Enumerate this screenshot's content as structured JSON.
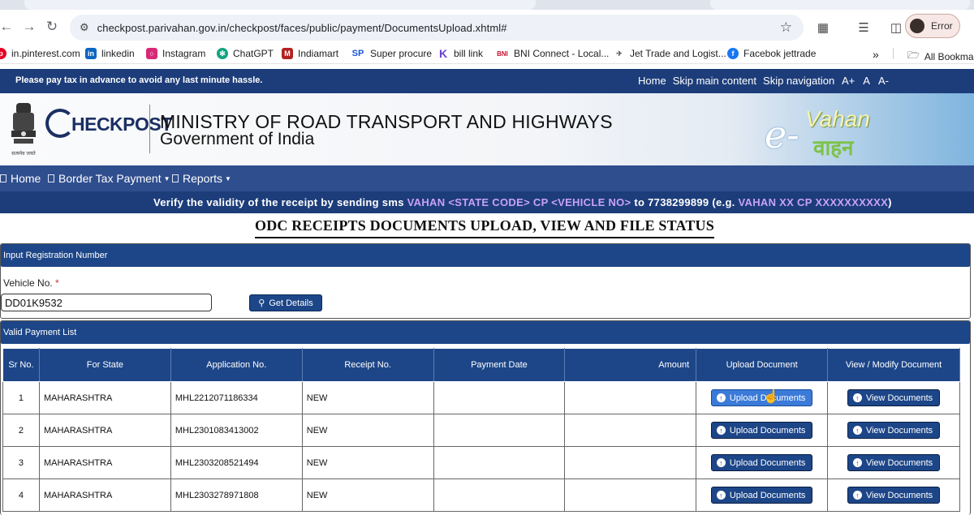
{
  "browser": {
    "url": "checkpost.parivahan.gov.in/checkpost/faces/public/payment/DocumentsUpload.xhtml#",
    "profile_status": "Error",
    "bookmarks": [
      {
        "label": "in.pinterest.com",
        "color": "#e60023"
      },
      {
        "label": "linkedin",
        "color": "#0a66c2"
      },
      {
        "label": "Instagram",
        "color": "#d62976"
      },
      {
        "label": "ChatGPT",
        "color": "#10a37f"
      },
      {
        "label": "Indiamart",
        "color": "#b22222"
      },
      {
        "label": "Super procure",
        "color": "#1a55d6"
      },
      {
        "label": "bill link",
        "color": "#6b3fd4"
      },
      {
        "label": "BNI Connect - Local...",
        "color": "#c8102e"
      },
      {
        "label": "Jet Trade and Logist...",
        "color": "#555555"
      },
      {
        "label": "Facebok jettrade",
        "color": "#1877f2"
      }
    ],
    "all_bookmarks": "All Bookmar"
  },
  "site": {
    "notice": "Please pay tax in advance to avoid any last minute hassle.",
    "top_links": [
      "Home",
      "Skip main content",
      "Skip navigation"
    ],
    "font_sizes": [
      "A+",
      "A",
      "A-"
    ],
    "logo": "HECKPOST",
    "ministry_line1": "MINISTRY OF ROAD TRANSPORT AND HIGHWAYS",
    "ministry_line2": "Government of India",
    "emblem_caption": "सत्यमेव जयते",
    "evahan_e": "e-",
    "evahan_vahan": "Vahan",
    "evahan_hindi": "वाहन",
    "menu": {
      "home": "Home",
      "border_tax": "Border Tax Payment",
      "reports": "Reports"
    },
    "sms": {
      "prefix": "Verify the validity of the receipt by sending sms",
      "code": "VAHAN <STATE CODE> CP <VEHICLE NO>",
      "middle": "to 7738299899 (e.g.",
      "example": "VAHAN XX CP XXXXXXXXXX",
      "suffix": ")"
    },
    "page_title": "ODC RECEIPTS DOCUMENTS UPLOAD, VIEW AND FILE STATUS"
  },
  "input_panel": {
    "heading": "Input Registration Number",
    "vehicle_label": "Vehicle No.",
    "required_mark": "*",
    "vehicle_value": "DD01K9532",
    "get_details": "Get Details"
  },
  "payment_panel": {
    "heading": "Valid Payment List",
    "columns": [
      "Sr No.",
      "For State",
      "Application No.",
      "Receipt No.",
      "Payment Date",
      "Amount",
      "Upload Document",
      "View / Modify Document"
    ],
    "upload_label": "Upload Documents",
    "view_label": "View Documents",
    "rows": [
      {
        "sr": "1",
        "state": "MAHARASHTRA",
        "app": "MHL2212071186334",
        "receipt": "NEW",
        "date": "",
        "amount": ""
      },
      {
        "sr": "2",
        "state": "MAHARASHTRA",
        "app": "MHL2301083413002",
        "receipt": "NEW",
        "date": "",
        "amount": ""
      },
      {
        "sr": "3",
        "state": "MAHARASHTRA",
        "app": "MHL2303208521494",
        "receipt": "NEW",
        "date": "",
        "amount": ""
      },
      {
        "sr": "4",
        "state": "MAHARASHTRA",
        "app": "MHL2303278971808",
        "receipt": "NEW",
        "date": "",
        "amount": ""
      }
    ]
  }
}
